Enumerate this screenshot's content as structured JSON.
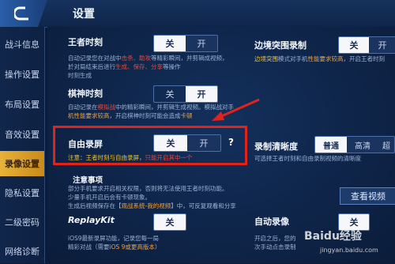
{
  "header": {
    "title": "设置"
  },
  "sidebar": {
    "items": [
      {
        "label": "战斗信息"
      },
      {
        "label": "操作设置"
      },
      {
        "label": "布局设置"
      },
      {
        "label": "音效设置"
      },
      {
        "label": "录像设置"
      },
      {
        "label": "隐私设置"
      },
      {
        "label": "二级密码"
      },
      {
        "label": "网络诊断"
      }
    ],
    "active_index": 4
  },
  "settings": {
    "king_moment": {
      "label": "王者时刻",
      "on": "关",
      "off": "开",
      "desc1_a": "自动记录您在对战中",
      "desc1_b": "击杀、助攻",
      "desc1_c": "等精彩瞬间，并剪辑成视频，",
      "desc2_a": "於对局结束后进行",
      "desc2_b": "生成、保存、分享",
      "desc2_c": "等操作",
      "desc3": "时刻生成"
    },
    "edge_record": {
      "label": "边境突围录制",
      "on": "关",
      "off": "开",
      "desc1_a": "边境突围",
      "desc1_b": "模式对手机",
      "desc1_c": "性能要求较高",
      "desc1_d": "，开启王者时刻"
    },
    "chess_moment": {
      "label": "棋神时刻",
      "on": "关",
      "off": "开",
      "desc1_a": "自动记录在",
      "desc1_b": "模拟战",
      "desc1_c": "中的精彩瞬间，并剪辑生成视频。模拟战对手",
      "desc2_a": "机性能要求较高",
      "desc2_b": "，开启棋神时刻可能会造成",
      "desc2_c": "卡顿"
    },
    "free_record": {
      "label": "自由录屏",
      "on": "关",
      "off": "开",
      "help": "?",
      "note_a": "注意：王者时刻与自由录屏，",
      "note_b": "只能开启其中一个"
    },
    "record_quality": {
      "label": "录制清晰度",
      "options": [
        "普通",
        "高清",
        "超"
      ],
      "selected_index": 0,
      "desc": "可选择王者时刻和自由录制视频的清晰度"
    },
    "notes": {
      "title": "注意事项",
      "line1": "部分手机要求开启相关权限，否则将无法使用王者时刻功能。",
      "line2": "少量手机开启后会有卡顿现象。",
      "line3_a": "生成后视频保存在【",
      "line3_b": "观战系统-我的视频",
      "line3_c": "】中，可反复观看和分享",
      "view_button": "查看视频"
    },
    "replaykit": {
      "label": "ReplayKit",
      "on": "关",
      "desc1": "iOS9最新录屏功能，记录您每一局",
      "desc2_a": "精彩对战（需要",
      "desc2_b": "iOS 9或更高版本",
      "desc2_c": "）"
    },
    "auto_record": {
      "label": "自动录像",
      "on": "关",
      "desc1": "开启之后，您的",
      "desc2": "次手动点击录制"
    }
  },
  "watermark": {
    "main": "Baidu经验",
    "sub": "jingyan.baidu.com"
  },
  "colors": {
    "accent": "#e9b23a",
    "highlight_red": "#e64a3c",
    "annotation_red": "#e2231a"
  }
}
